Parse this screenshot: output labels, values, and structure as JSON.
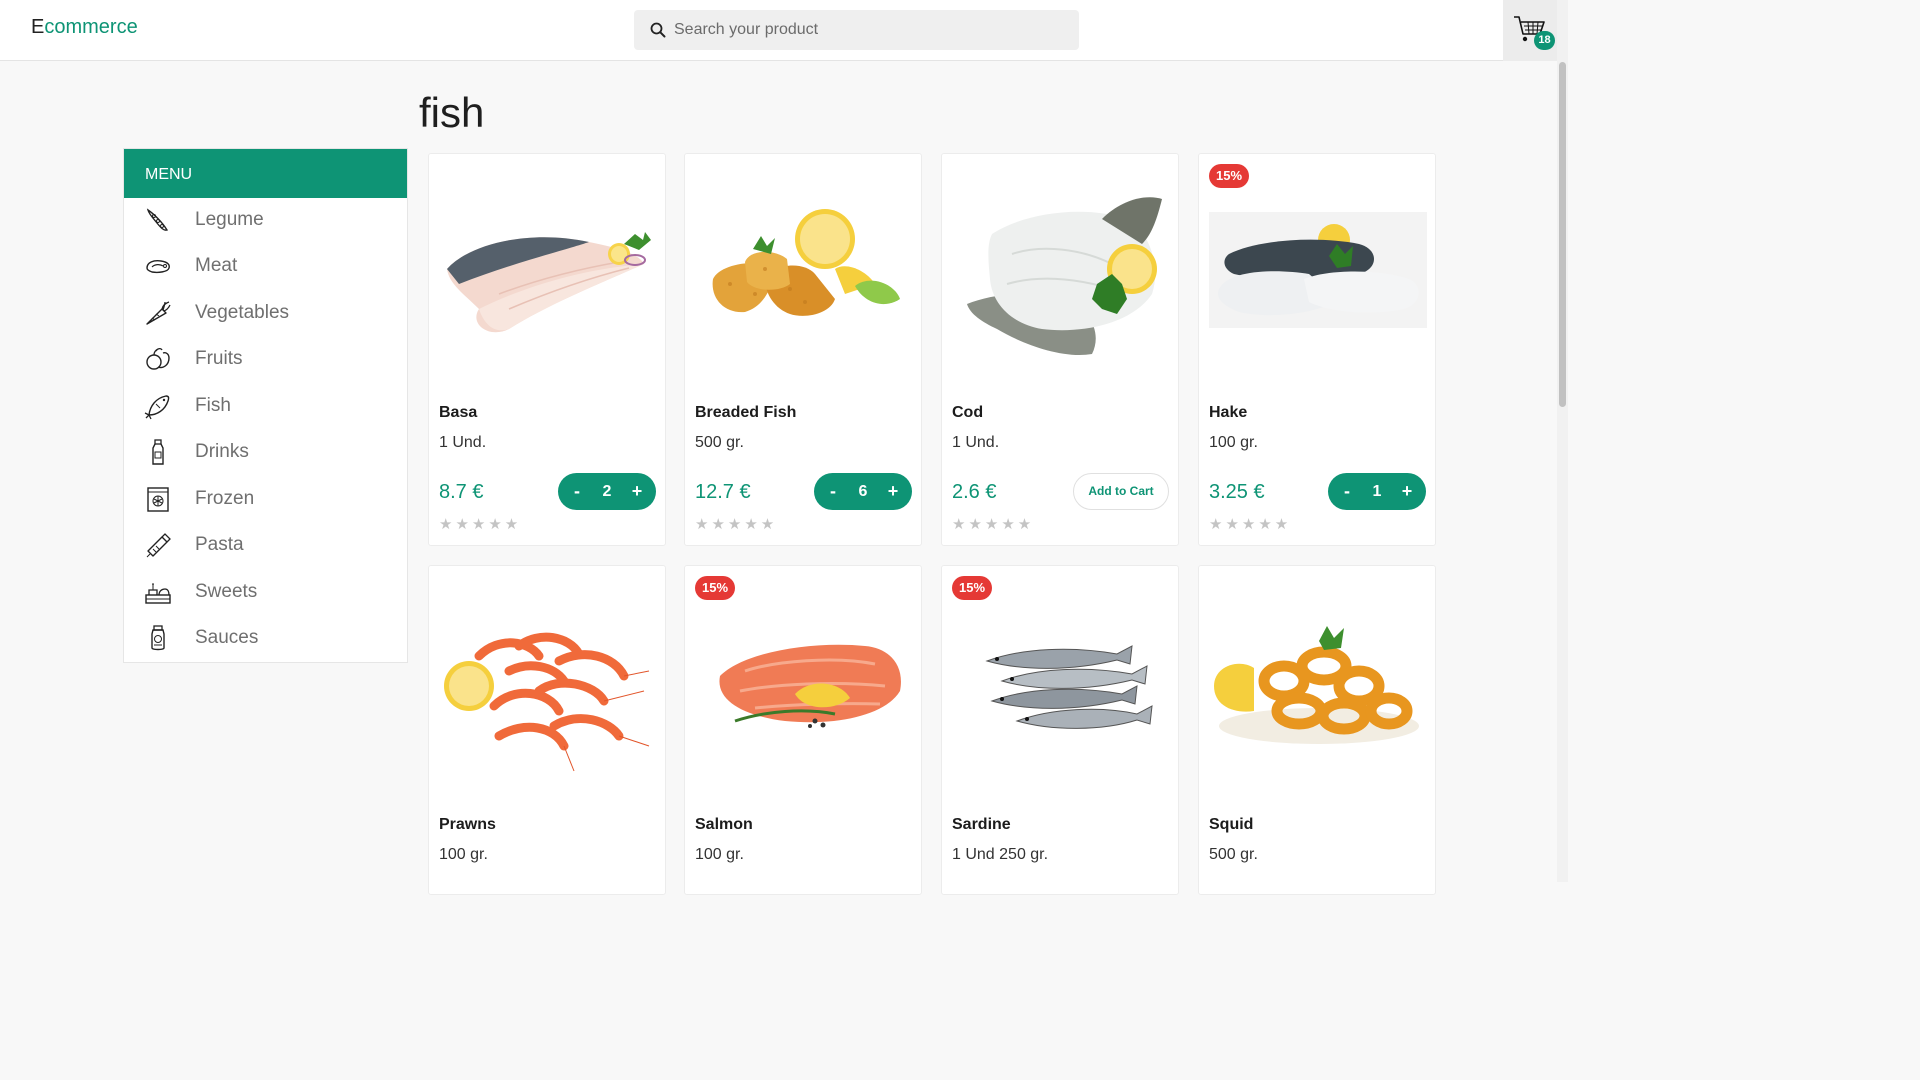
{
  "brand": {
    "first_letter": "E",
    "rest": "commerce"
  },
  "search": {
    "placeholder": "Search your product"
  },
  "cart": {
    "count": "18"
  },
  "page": {
    "title": "fish"
  },
  "sidebar": {
    "header": "MENU",
    "items": [
      {
        "label": "Legume",
        "icon": "legume-icon"
      },
      {
        "label": "Meat",
        "icon": "meat-icon"
      },
      {
        "label": "Vegetables",
        "icon": "vegetables-icon"
      },
      {
        "label": "Fruits",
        "icon": "fruits-icon"
      },
      {
        "label": "Fish",
        "icon": "fish-icon"
      },
      {
        "label": "Drinks",
        "icon": "drinks-icon"
      },
      {
        "label": "Frozen",
        "icon": "frozen-icon"
      },
      {
        "label": "Pasta",
        "icon": "pasta-icon"
      },
      {
        "label": "Sweets",
        "icon": "sweets-icon"
      },
      {
        "label": "Sauces",
        "icon": "sauces-icon"
      }
    ]
  },
  "products": [
    {
      "name": "Basa",
      "unit": "1 Und.",
      "price": "8.7 €",
      "qty": "2",
      "stars": "★★★★★",
      "badge": ""
    },
    {
      "name": "Breaded Fish",
      "unit": "500 gr.",
      "price": "12.7 €",
      "qty": "6",
      "stars": "★★★★★",
      "badge": ""
    },
    {
      "name": "Cod",
      "unit": "1 Und.",
      "price": "2.6 €",
      "add_label": "Add to Cart",
      "stars": "★★★★★",
      "badge": ""
    },
    {
      "name": "Hake",
      "unit": "100 gr.",
      "price": "3.25 €",
      "qty": "1",
      "stars": "★★★★★",
      "badge": "15%"
    },
    {
      "name": "Prawns",
      "unit": "100 gr.",
      "badge": ""
    },
    {
      "name": "Salmon",
      "unit": "100 gr.",
      "badge": "15%"
    },
    {
      "name": "Sardine",
      "unit": "1 Und 250 gr.",
      "badge": "15%"
    },
    {
      "name": "Squid",
      "unit": "500 gr.",
      "badge": ""
    }
  ],
  "qty_controls": {
    "minus": "-",
    "plus": "+"
  },
  "colors": {
    "accent": "#0e9475",
    "discount": "#e53935"
  }
}
